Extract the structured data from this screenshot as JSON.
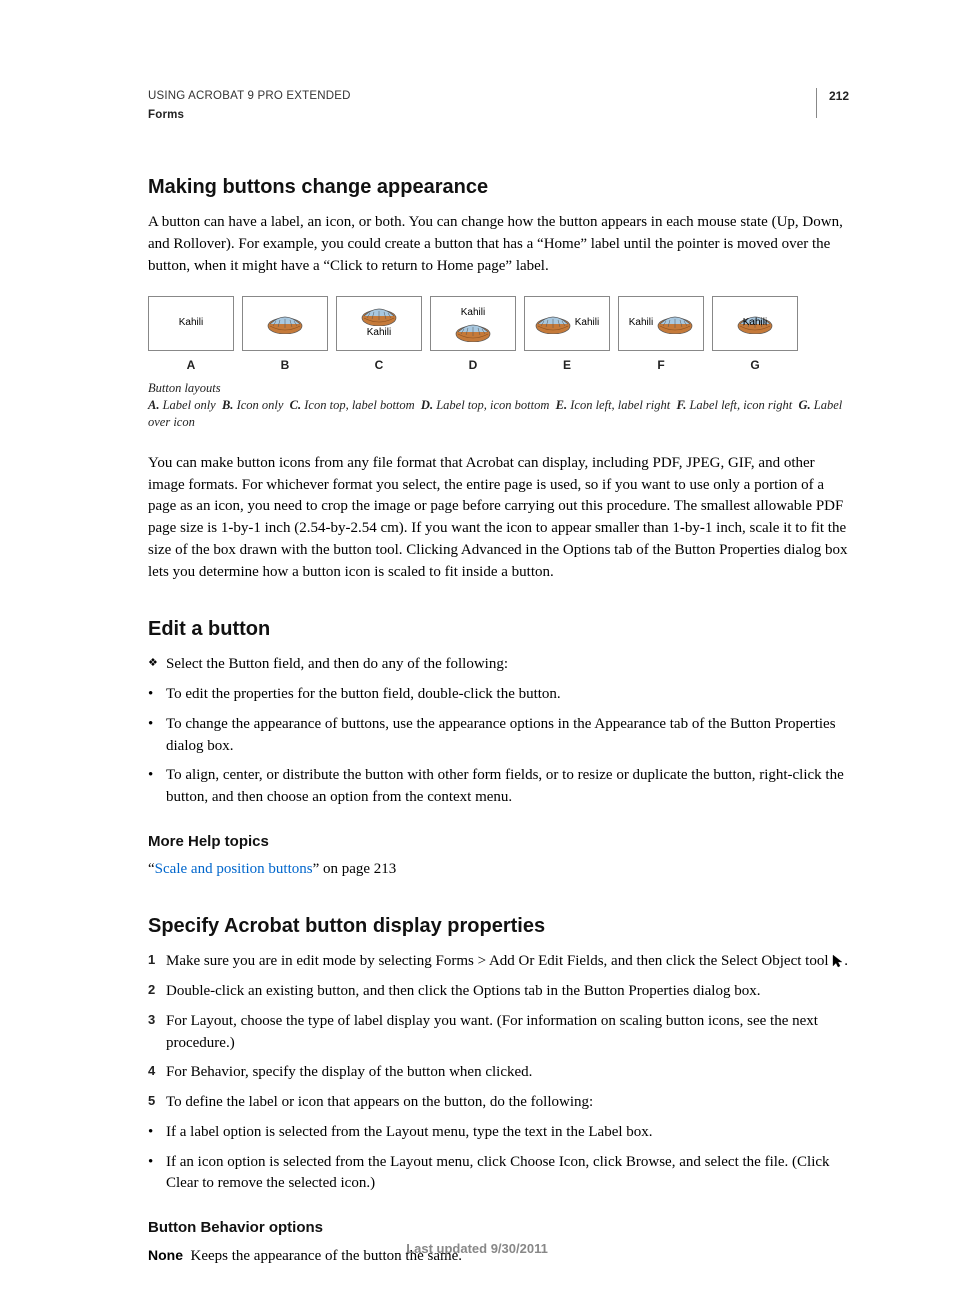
{
  "header": {
    "title": "USING ACROBAT 9 PRO EXTENDED",
    "section": "Forms",
    "page_number": "212"
  },
  "h1": "Making buttons change appearance",
  "p1": "A button can have a label, an icon, or both. You can change how the button appears in each mouse state (Up, Down, and Rollover). For example, you could create a button that has a “Home” label until the pointer is moved over the button, when it might have a “Click to return to Home page” label.",
  "figure": {
    "label_text": "Kahili",
    "letters": [
      "A",
      "B",
      "C",
      "D",
      "E",
      "F",
      "G"
    ],
    "caption_title": "Button layouts",
    "legend": [
      {
        "k": "A.",
        "v": "Label only"
      },
      {
        "k": "B.",
        "v": "Icon only"
      },
      {
        "k": "C.",
        "v": "Icon top, label bottom"
      },
      {
        "k": "D.",
        "v": "Label top, icon bottom"
      },
      {
        "k": "E.",
        "v": "Icon left, label right"
      },
      {
        "k": "F.",
        "v": "Label left, icon right"
      },
      {
        "k": "G.",
        "v": "Label over icon"
      }
    ]
  },
  "p2": "You can make button icons from any file format that Acrobat can display, including PDF, JPEG, GIF, and other image formats. For whichever format you select, the entire page is used, so if you want to use only a portion of a page as an icon, you need to crop the image or page before carrying out this procedure. The smallest allowable PDF page size is 1-by-1 inch (2.54-by-2.54 cm). If you want the icon to appear smaller than 1-by-1 inch, scale it to fit the size of the box drawn with the button tool. Clicking Advanced in the Options tab of the Button Properties dialog box lets you determine how a button icon is scaled to fit inside a button.",
  "h2": "Edit a button",
  "edit_intro": "Select the Button field, and then do any of the following:",
  "edit_bullets": [
    "To edit the properties for the button field, double-click the button.",
    "To change the appearance of buttons, use the appearance options in the Appearance tab of the Button Properties dialog box.",
    "To align, center, or distribute the button with other form fields, or to resize or duplicate the button, right-click the button, and then choose an option from the context menu."
  ],
  "more_help": {
    "heading": "More Help topics",
    "quote_open": "“",
    "link_text": "Scale and position buttons",
    "tail": "” on page 213"
  },
  "h3": "Specify Acrobat button display properties",
  "steps": [
    "Make sure you are in edit mode by selecting Forms > Add Or Edit Fields, and then click the Select Object tool ",
    "Double-click an existing button, and then click the Options tab in the Button Properties dialog box.",
    "For Layout, choose the type of label display you want. (For information on scaling button icons, see the next procedure.)",
    "For Behavior, specify the display of the button when clicked.",
    "To define the label or icon that appears on the button, do the following:"
  ],
  "step_nums": [
    "1",
    "2",
    "3",
    "4",
    "5"
  ],
  "step1_tail": ".",
  "step_bullets": [
    "If a label option is selected from the Layout menu, type the text in the Label box.",
    "If an icon option is selected from the Layout menu, click Choose Icon, click Browse, and select the file. (Click Clear to remove the selected icon.)"
  ],
  "h4": "Button Behavior options",
  "behavior": {
    "name": "None",
    "desc": "Keeps the appearance of the button the same."
  },
  "footer": "Last updated 9/30/2011"
}
